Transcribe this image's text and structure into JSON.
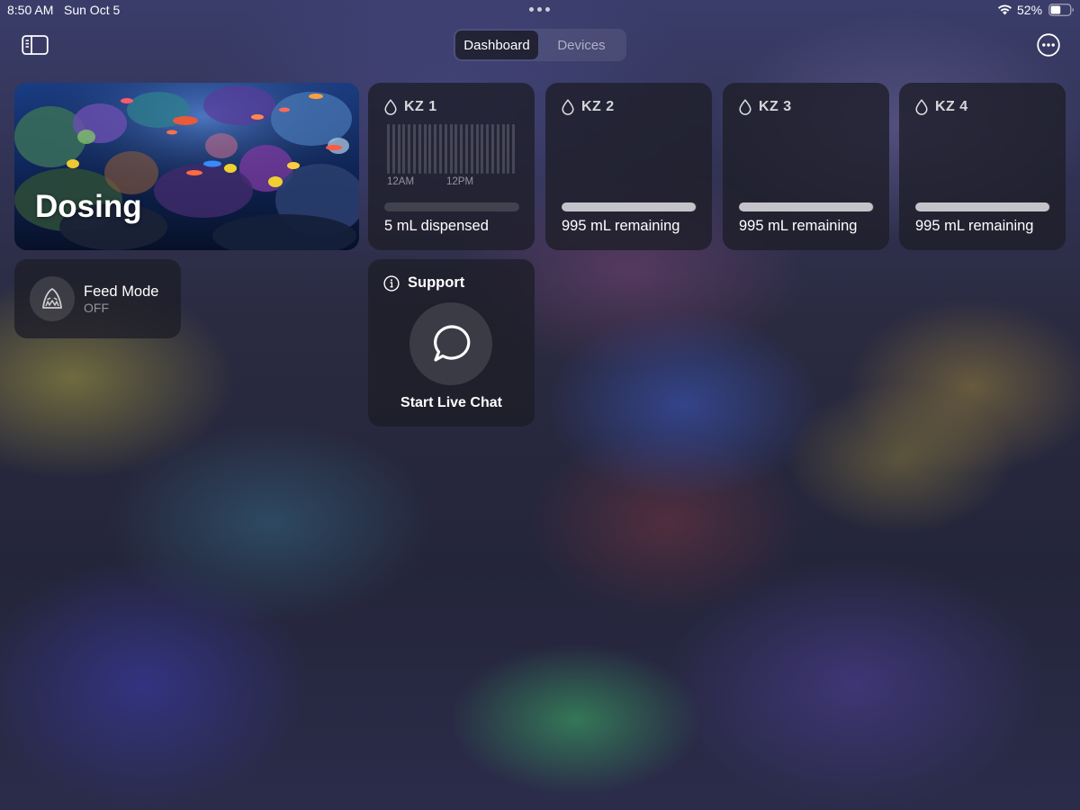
{
  "status_bar": {
    "time": "8:50 AM",
    "date": "Sun Oct 5",
    "battery_percent": "52%",
    "battery_level": 0.52,
    "icons": [
      "multitask-dots-icon",
      "wifi-icon",
      "battery-icon"
    ]
  },
  "nav": {
    "sidebar_icon": "sidebar-toggle-icon",
    "tabs": [
      {
        "label": "Dashboard",
        "selected": true
      },
      {
        "label": "Devices",
        "selected": false
      }
    ],
    "more_icon": "ellipsis-circle-icon"
  },
  "dosing": {
    "title": "Dosing"
  },
  "pumps": [
    {
      "name": "KZ 1",
      "icon": "drop-icon",
      "status": "5 mL dispensed",
      "level": 0,
      "show_schedule": true,
      "ticks": [
        "12AM",
        "12PM"
      ]
    },
    {
      "name": "KZ 2",
      "icon": "drop-icon",
      "status": "995 mL remaining",
      "level": 0.995,
      "show_schedule": false
    },
    {
      "name": "KZ 3",
      "icon": "drop-icon",
      "status": "995 mL remaining",
      "level": 0.995,
      "show_schedule": false
    },
    {
      "name": "KZ 4",
      "icon": "drop-icon",
      "status": "995 mL remaining",
      "level": 0.995,
      "show_schedule": false
    }
  ],
  "feed_mode": {
    "title": "Feed Mode",
    "state": "OFF",
    "icon": "shark-icon"
  },
  "support": {
    "title": "Support",
    "icon": "info-icon",
    "action_label": "Start Live Chat",
    "action_icon": "chat-bubble-icon"
  }
}
